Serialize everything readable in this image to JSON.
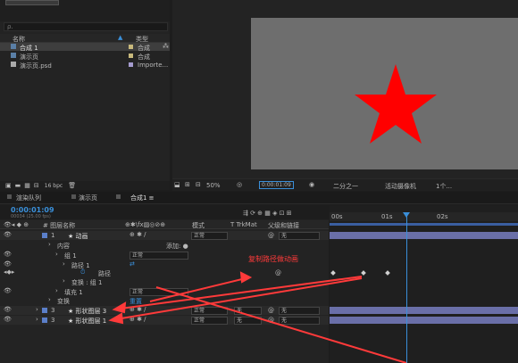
{
  "project": {
    "search_placeholder": "ρ.",
    "col_name": "名称",
    "col_type": "类型",
    "items": [
      {
        "name": "合成 1",
        "type": "合成"
      },
      {
        "name": "演示页",
        "type": "合成"
      },
      {
        "name": "演示页.psd",
        "type": "Importe..."
      }
    ],
    "bpc": "16 bpc"
  },
  "viewer": {
    "zoom": "50%",
    "timecode": "0:00:01:09",
    "quality": "二分之一",
    "camera": "活动摄像机",
    "views": "1个..."
  },
  "tabs": [
    {
      "label": "渲染队列"
    },
    {
      "label": "演示页"
    },
    {
      "label": "合成1 ≡"
    }
  ],
  "timeline": {
    "timecode": "0:00:01:09",
    "fps": "00034 (25.00 fps)",
    "headers": {
      "src": "# 图层名称",
      "mode": "模式",
      "trkmat": "T TrkMat",
      "parent": "父级和链接"
    },
    "ticks": [
      "00s",
      "01s",
      "02s"
    ],
    "annotation": "复制路径做动画",
    "add_label": "添加: ●",
    "reset_label": "重置",
    "layers": [
      {
        "num": "1",
        "name": "★ 动画",
        "mode": "正常",
        "trk": "",
        "parent": "无"
      },
      {
        "num": "",
        "name": "内容",
        "mode": "",
        "trk": "",
        "parent": ""
      },
      {
        "num": "",
        "name": "组 1",
        "mode": "正常",
        "trk": "",
        "parent": ""
      },
      {
        "num": "",
        "name": "路径 1",
        "mode": "",
        "trk": "",
        "parent": ""
      },
      {
        "num": "",
        "name": "路径",
        "mode": "",
        "trk": "",
        "parent": ""
      },
      {
        "num": "",
        "name": "变换 : 组 1",
        "mode": "",
        "trk": "",
        "parent": ""
      },
      {
        "num": "",
        "name": "填充 1",
        "mode": "正常",
        "trk": "",
        "parent": ""
      },
      {
        "num": "",
        "name": "变换",
        "mode": "",
        "trk": "",
        "parent": ""
      },
      {
        "num": "3",
        "name": "★ 形状图层 3",
        "mode": "正常",
        "trk": "无",
        "parent": "无"
      },
      {
        "num": "3",
        "name": "★ 形状图层 1",
        "mode": "正常",
        "trk": "无",
        "parent": "无"
      }
    ]
  },
  "colors": {
    "star": "#ff0000",
    "accent": "#3a8fd9",
    "annotation": "#ff3a3a",
    "bar": "#6a6fa8"
  }
}
